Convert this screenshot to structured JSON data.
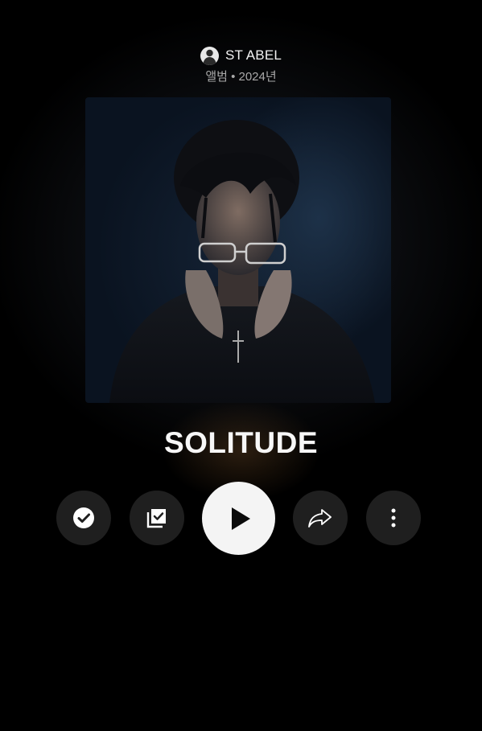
{
  "header": {
    "artist_name": "ST ABEL",
    "meta": "앨범 • 2024년"
  },
  "album": {
    "title": "SOLITUDE",
    "cover_icon": "album-cover-image"
  },
  "controls": {
    "saved_icon": "check-circle-icon",
    "library_icon": "library-added-icon",
    "play_icon": "play-icon",
    "share_icon": "share-icon",
    "more_icon": "more-vertical-icon"
  },
  "colors": {
    "background": "#000000",
    "button_bg": "#1f1f1f",
    "play_bg": "#f4f4f4",
    "text_primary": "#f2f2f2",
    "text_secondary": "#a9a9a9"
  }
}
